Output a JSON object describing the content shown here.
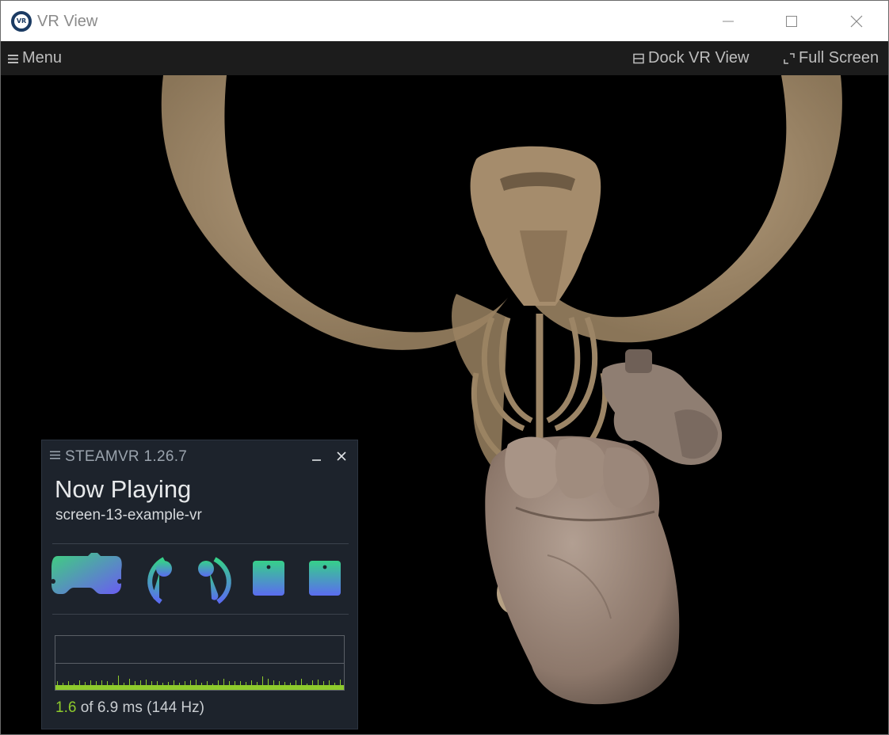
{
  "window": {
    "title": "VR View",
    "icon_label": "VR",
    "controls": [
      "minimize-icon",
      "maximize-icon",
      "close-icon"
    ]
  },
  "menubar": {
    "menu_label": "Menu",
    "dock_label": "Dock VR View",
    "fullscreen_label": "Full Screen"
  },
  "viewport": {
    "scene": "mammoth-skeleton-with-hands",
    "colors": {
      "background": "#000000",
      "bone": "#a58c6c",
      "hand": "#a08a7a"
    }
  },
  "steamvr": {
    "title": "STEAMVR 1.26.7",
    "heading": "Now Playing",
    "app_name": "screen-13-example-vr",
    "devices": [
      {
        "name": "headset-icon"
      },
      {
        "name": "controller-left-icon"
      },
      {
        "name": "controller-right-icon"
      },
      {
        "name": "tracker-1-icon"
      },
      {
        "name": "tracker-2-icon"
      }
    ],
    "timing": {
      "value": "1.6",
      "rest": "of 6.9 ms (144 Hz)"
    },
    "colors": {
      "panel": "#1d232c",
      "accent_green": "#8ecb2c",
      "device_gradient_top": "#36d08a",
      "device_gradient_bottom": "#5b6cf0"
    }
  }
}
